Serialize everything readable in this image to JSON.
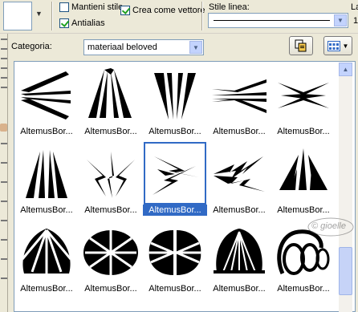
{
  "toolbar": {
    "checkbox_mantieni": {
      "label": "Mantieni stile",
      "checked": false
    },
    "checkbox_antialias": {
      "label": "Antialias",
      "checked": true
    },
    "checkbox_vettore": {
      "label": "Crea come vettore",
      "checked": true
    },
    "stile_linea_label": "Stile linea:",
    "cut_label_1": "La",
    "cut_label_2": "1"
  },
  "categoria": {
    "label": "Categoria:",
    "value": "materiaal beloved"
  },
  "gallery": {
    "items": [
      {
        "caption": "AltemusBor...",
        "icon": "burst-bars-pair"
      },
      {
        "caption": "AltemusBor...",
        "icon": "spikes-up"
      },
      {
        "caption": "AltemusBor...",
        "icon": "spikes-down"
      },
      {
        "caption": "AltemusBor...",
        "icon": "burst-bars-wide"
      },
      {
        "caption": "AltemusBor...",
        "icon": "burst-bars-small"
      },
      {
        "caption": "AltemusBor...",
        "icon": "spikes-tall"
      },
      {
        "caption": "AltemusBor...",
        "icon": "spikes-lightning"
      },
      {
        "caption": "AltemusBor...",
        "icon": "lightning-pair",
        "selected": true
      },
      {
        "caption": "AltemusBor...",
        "icon": "lightning-zigzag"
      },
      {
        "caption": "AltemusBor...",
        "icon": "spikes-arc"
      },
      {
        "caption": "AltemusBor...",
        "icon": "shell-fan"
      },
      {
        "caption": "AltemusBor...",
        "icon": "shell-split"
      },
      {
        "caption": "AltemusBor...",
        "icon": "shell-split-2"
      },
      {
        "caption": "AltemusBor...",
        "icon": "shell-rays"
      },
      {
        "caption": "AltemusBor...",
        "icon": "swirl-loops"
      }
    ]
  },
  "watermark": "© gioelle",
  "colors": {
    "selection": "#316ac5",
    "window": "#ece9d8",
    "border": "#7f9db9"
  }
}
